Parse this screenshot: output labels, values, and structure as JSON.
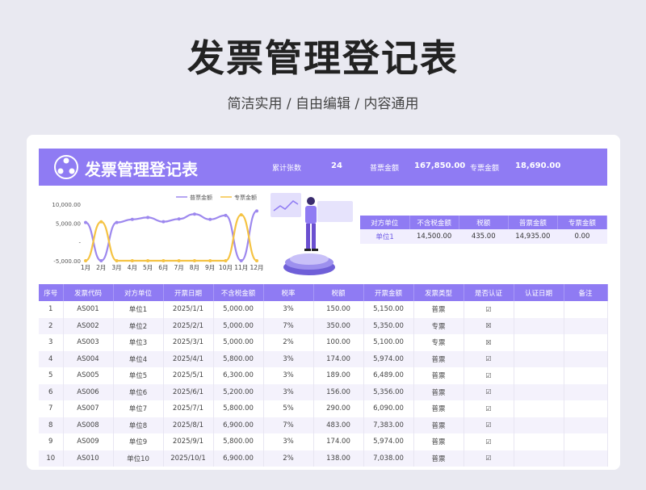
{
  "hero": {
    "title": "发票管理登记表",
    "subtitle": "简洁实用 / 自由编辑 / 内容通用"
  },
  "banner": {
    "title": "发票管理登记表",
    "count_label": "累计张数",
    "count_value": "24",
    "normal_label": "普票金额",
    "normal_value": "167,850.00",
    "special_label": "专票金额",
    "special_value": "18,690.00"
  },
  "colors": {
    "accent": "#8f7bf3",
    "series_normal": "#9d88ee",
    "series_special": "#f5c343"
  },
  "chart_data": {
    "type": "line",
    "categories": [
      "1月",
      "2月",
      "3月",
      "4月",
      "5月",
      "6月",
      "7月",
      "8月",
      "9月",
      "10月",
      "11月",
      "12月"
    ],
    "series": [
      {
        "name": "普票金额",
        "values": [
          5150,
          -5000,
          5150,
          5974,
          6489,
          5356,
          6090,
          7383,
          5974,
          7036,
          -5000,
          8200
        ]
      },
      {
        "name": "专票金额",
        "values": [
          -5000,
          5350,
          -5000,
          -5000,
          -5000,
          -5000,
          -5000,
          -5000,
          -5000,
          -5000,
          7200,
          -5000
        ]
      }
    ],
    "yticks": [
      "10,000.00",
      "5,000.00",
      "-",
      "-5,000.00"
    ],
    "ylim": [
      -5000,
      10000
    ]
  },
  "summary": {
    "headers": [
      "对方单位",
      "不含税金额",
      "税额",
      "普票金额",
      "专票金额"
    ],
    "row": [
      "单位1",
      "14,500.00",
      "435.00",
      "14,935.00",
      "0.00"
    ]
  },
  "table": {
    "headers": [
      "序号",
      "发票代码",
      "对方单位",
      "开票日期",
      "不含税金额",
      "税率",
      "税额",
      "开票金额",
      "发票类型",
      "是否认证",
      "认证日期",
      "备注"
    ],
    "rows": [
      [
        "1",
        "AS001",
        "单位1",
        "2025/1/1",
        "5,000.00",
        "3%",
        "150.00",
        "5,150.00",
        "普票",
        "☑",
        "",
        ""
      ],
      [
        "2",
        "AS002",
        "单位2",
        "2025/2/1",
        "5,000.00",
        "7%",
        "350.00",
        "5,350.00",
        "专票",
        "☒",
        "",
        ""
      ],
      [
        "3",
        "AS003",
        "单位3",
        "2025/3/1",
        "5,000.00",
        "2%",
        "100.00",
        "5,100.00",
        "专票",
        "☒",
        "",
        ""
      ],
      [
        "4",
        "AS004",
        "单位4",
        "2025/4/1",
        "5,800.00",
        "3%",
        "174.00",
        "5,974.00",
        "普票",
        "☑",
        "",
        ""
      ],
      [
        "5",
        "AS005",
        "单位5",
        "2025/5/1",
        "6,300.00",
        "3%",
        "189.00",
        "6,489.00",
        "普票",
        "☑",
        "",
        ""
      ],
      [
        "6",
        "AS006",
        "单位6",
        "2025/6/1",
        "5,200.00",
        "3%",
        "156.00",
        "5,356.00",
        "普票",
        "☑",
        "",
        ""
      ],
      [
        "7",
        "AS007",
        "单位7",
        "2025/7/1",
        "5,800.00",
        "5%",
        "290.00",
        "6,090.00",
        "普票",
        "☑",
        "",
        ""
      ],
      [
        "8",
        "AS008",
        "单位8",
        "2025/8/1",
        "6,900.00",
        "7%",
        "483.00",
        "7,383.00",
        "普票",
        "☑",
        "",
        ""
      ],
      [
        "9",
        "AS009",
        "单位9",
        "2025/9/1",
        "5,800.00",
        "3%",
        "174.00",
        "5,974.00",
        "普票",
        "☑",
        "",
        ""
      ],
      [
        "10",
        "AS010",
        "单位10",
        "2025/10/1",
        "6,900.00",
        "2%",
        "138.00",
        "7,038.00",
        "普票",
        "☑",
        "",
        ""
      ]
    ]
  }
}
